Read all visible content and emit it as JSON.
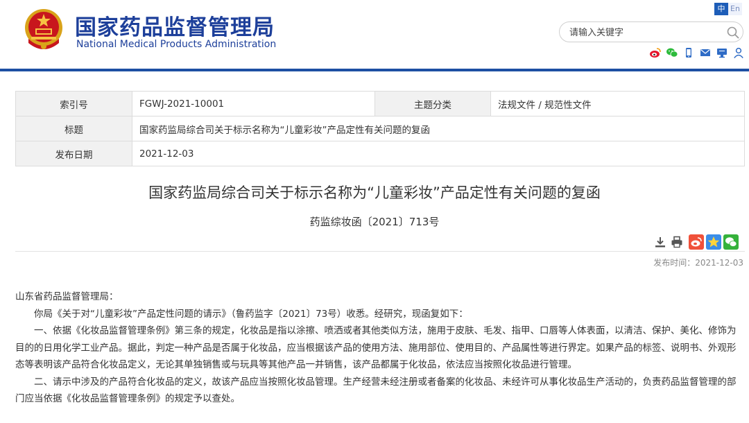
{
  "header": {
    "title_cn": "国家药品监督管理局",
    "title_en": "National Medical Products Administration",
    "lang_cn": "中",
    "lang_en": "En",
    "search_placeholder": "请输入关键字",
    "icons": [
      "national-emblem",
      "weibo-icon",
      "wechat-icon",
      "mobile-icon",
      "email-icon",
      "feedback-icon",
      "user-icon"
    ],
    "accent_color": "#1d4fa3"
  },
  "meta": {
    "index_label": "索引号",
    "index_value": "FGWJ-2021-10001",
    "topic_label": "主题分类",
    "topic_value": "法规文件 / 规范性文件",
    "title_label": "标题",
    "title_value": "国家药监局综合司关于标示名称为“儿童彩妆”产品定性有关问题的复函",
    "date_label": "发布日期",
    "date_value": "2021-12-03"
  },
  "doc": {
    "title": "国家药监局综合司关于标示名称为“儿童彩妆”产品定性有关问题的复函",
    "number": "药监综妆函〔2021〕713号",
    "publish_time": "发布时间：2021-12-03",
    "tool_icons": [
      "download-icon",
      "print-icon",
      "share-weibo-icon",
      "share-qzone-icon",
      "share-wechat-icon"
    ]
  },
  "body": {
    "salutation": "山东省药品监督管理局：",
    "p1": "你局《关于对“儿童彩妆”产品定性问题的请示》（鲁药监字〔2021〕73号）收悉。经研究，现函复如下：",
    "p2": "一、依据《化妆品监督管理条例》第三条的规定，化妆品是指以涂擦、喷洒或者其他类似方法，施用于皮肤、毛发、指甲、口唇等人体表面，以清洁、保护、美化、修饰为目的的日用化学工业产品。据此，判定一种产品是否属于化妆品，应当根据该产品的使用方法、施用部位、使用目的、产品属性等进行界定。如果产品的标签、说明书、外观形态等表明该产品符合化妆品定义，无论其单独销售或与玩具等其他产品一并销售，该产品都属于化妆品，依法应当按照化妆品进行管理。",
    "p3": "二、请示中涉及的产品符合化妆品的定义，故该产品应当按照化妆品管理。生产经营未经注册或者备案的化妆品、未经许可从事化妆品生产活动的，负责药品监督管理的部门应当依据《化妆品监督管理条例》的规定予以查处。"
  }
}
